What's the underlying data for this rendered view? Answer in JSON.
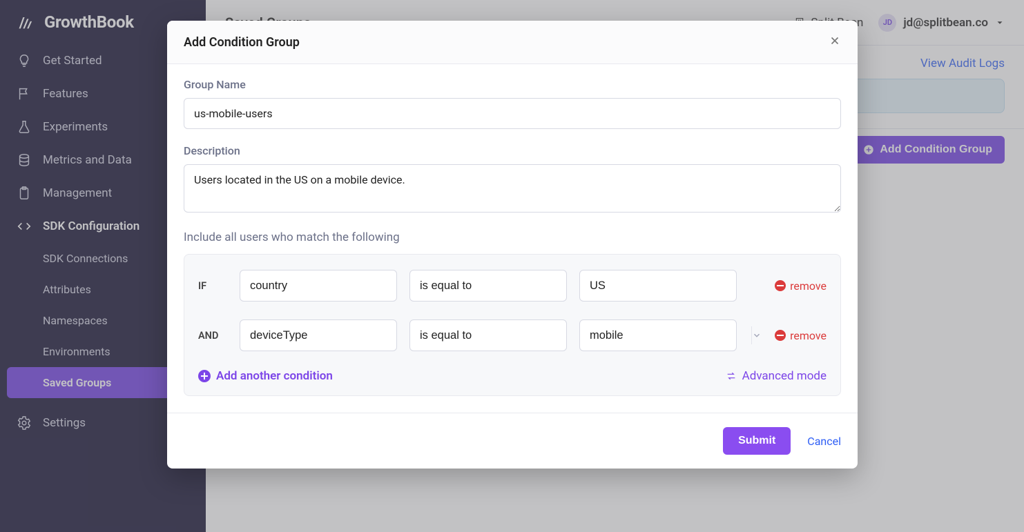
{
  "brand": "GrowthBook",
  "sidebar": {
    "items": [
      {
        "label": "Get Started"
      },
      {
        "label": "Features"
      },
      {
        "label": "Experiments"
      },
      {
        "label": "Metrics and Data"
      },
      {
        "label": "Management"
      },
      {
        "label": "SDK Configuration"
      }
    ],
    "subitems": [
      {
        "label": "SDK Connections"
      },
      {
        "label": "Attributes"
      },
      {
        "label": "Namespaces"
      },
      {
        "label": "Environments"
      },
      {
        "label": "Saved Groups"
      }
    ],
    "settings": "Settings"
  },
  "topbar": {
    "page_title": "Saved Groups",
    "org_name": "Split Bean",
    "user_initials": "JD",
    "user_email": "jd@splitbean.co"
  },
  "links": {
    "audit": "View Audit Logs"
  },
  "buttons": {
    "add_condition_group": "Add Condition Group"
  },
  "modal": {
    "title": "Add Condition Group",
    "group_name_label": "Group Name",
    "group_name_value": "us-mobile-users",
    "description_label": "Description",
    "description_value": "Users located in the US on a mobile device.",
    "conditions_label": "Include all users who match the following",
    "rows": [
      {
        "prefix": "IF",
        "attr": "country",
        "op": "is equal to",
        "val": "US"
      },
      {
        "prefix": "AND",
        "attr": "deviceType",
        "op": "is equal to",
        "val": "mobile"
      }
    ],
    "remove_label": "remove",
    "add_another": "Add another condition",
    "advanced": "Advanced mode",
    "submit": "Submit",
    "cancel": "Cancel"
  }
}
